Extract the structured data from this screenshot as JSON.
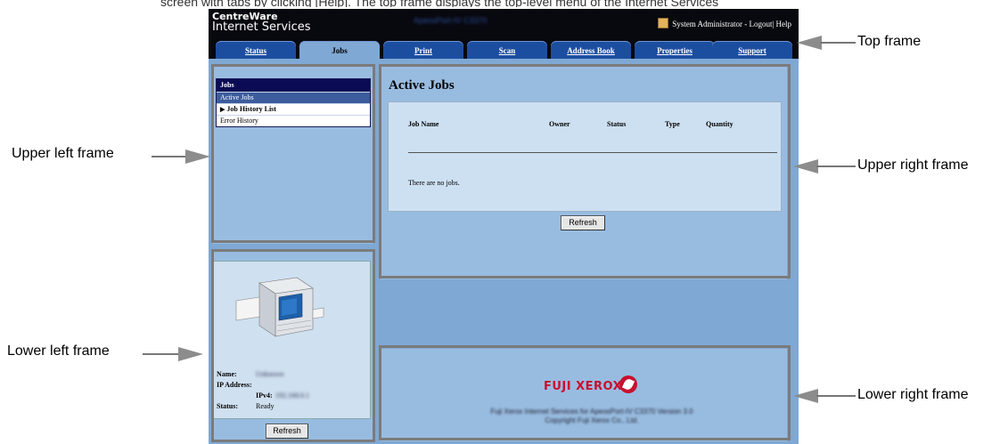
{
  "caption": "screen with tabs by clicking [Help]. The top frame displays the top-level menu of the Internet Services",
  "header": {
    "logo_line1": "CentreWare",
    "logo_line2": "Internet Services",
    "model": "ApeosPort-IV C3370",
    "user_links": "System Administrator - Logout| Help"
  },
  "tabs": [
    "Status",
    "Jobs",
    "Print",
    "Scan",
    "Address Book",
    "Properties",
    "Support"
  ],
  "active_tab": "Jobs",
  "menu": {
    "title": "Jobs",
    "items": [
      {
        "label": "Active Jobs",
        "selected": true
      },
      {
        "label": "Job History List",
        "expandable": true
      },
      {
        "label": "Error History"
      }
    ]
  },
  "active_jobs": {
    "title": "Active Jobs",
    "columns": [
      "Job Name",
      "Owner",
      "Status",
      "Type",
      "Quantity"
    ],
    "empty_message": "There are no jobs.",
    "refresh_label": "Refresh"
  },
  "device": {
    "name_label": "Name:",
    "name_value": "Unknown",
    "ip_label": "IP Address:",
    "ipv4_label": "IPv4:",
    "ipv4_value": "192.168.0.1",
    "status_label": "Status:",
    "status_value": "Ready",
    "refresh_label": "Refresh"
  },
  "footer": {
    "brand": "FUJI XEROX",
    "copyright_line1": "Fuji Xerox Internet Services for ApeosPort-IV C3370 Version 3.0",
    "copyright_line2": "Copyright Fuji Xerox Co., Ltd."
  },
  "callouts": {
    "top_frame": "Top frame",
    "upper_left": "Upper left frame",
    "upper_right": "Upper right frame",
    "lower_left": "Lower left frame",
    "lower_right": "Lower right frame"
  },
  "colors": {
    "background": "#7fa8d4",
    "header": "#08080f",
    "tab": "#1c4ea0",
    "brand_red": "#c8102e"
  }
}
